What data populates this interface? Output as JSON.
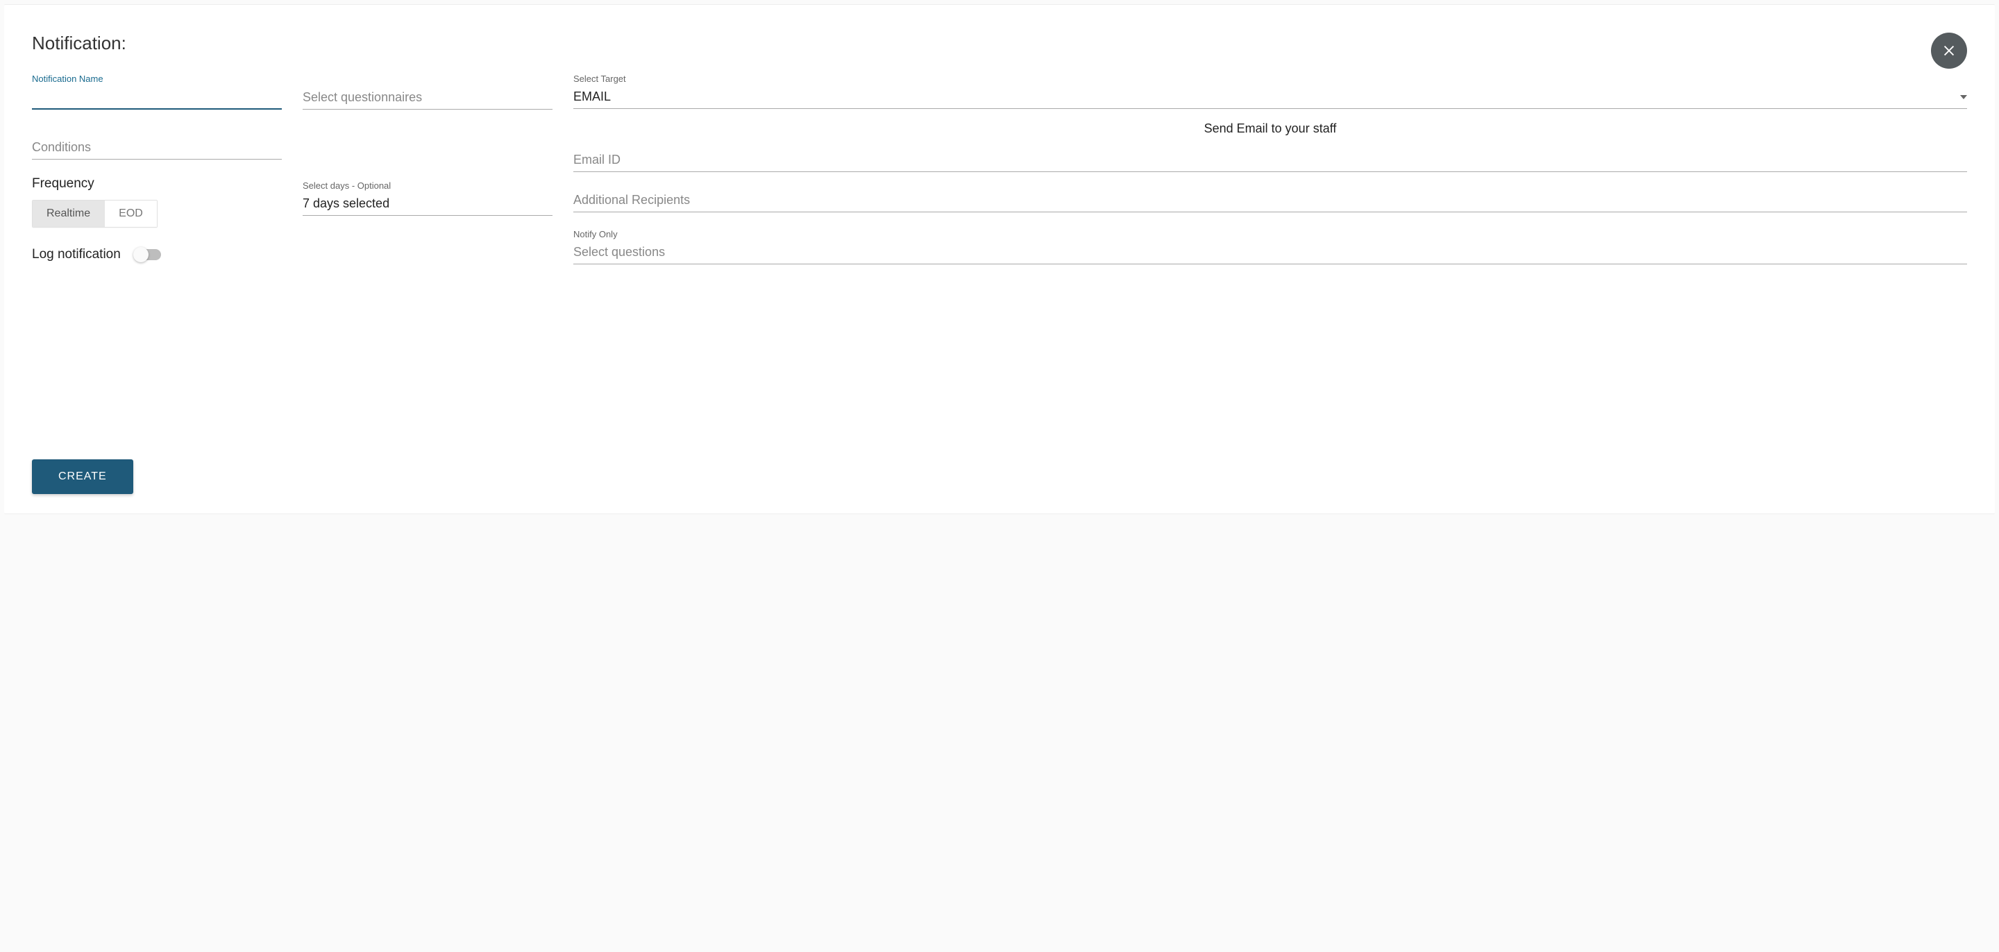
{
  "title": "Notification:",
  "left": {
    "name_label": "Notification Name",
    "name_value": "",
    "conditions_placeholder": "Conditions",
    "frequency_label": "Frequency",
    "freq_options": {
      "realtime": "Realtime",
      "eod": "EOD"
    },
    "log_label": "Log notification"
  },
  "mid": {
    "questionnaires_placeholder": "Select questionnaires",
    "days_label": "Select days - Optional",
    "days_value": "7 days selected"
  },
  "right": {
    "target_label": "Select Target",
    "target_value": "EMAIL",
    "helper": "Send Email to your staff",
    "email_placeholder": "Email ID",
    "recipients_placeholder": "Additional Recipients",
    "notify_label": "Notify Only",
    "notify_placeholder": "Select questions"
  },
  "create_label": "CREATE"
}
